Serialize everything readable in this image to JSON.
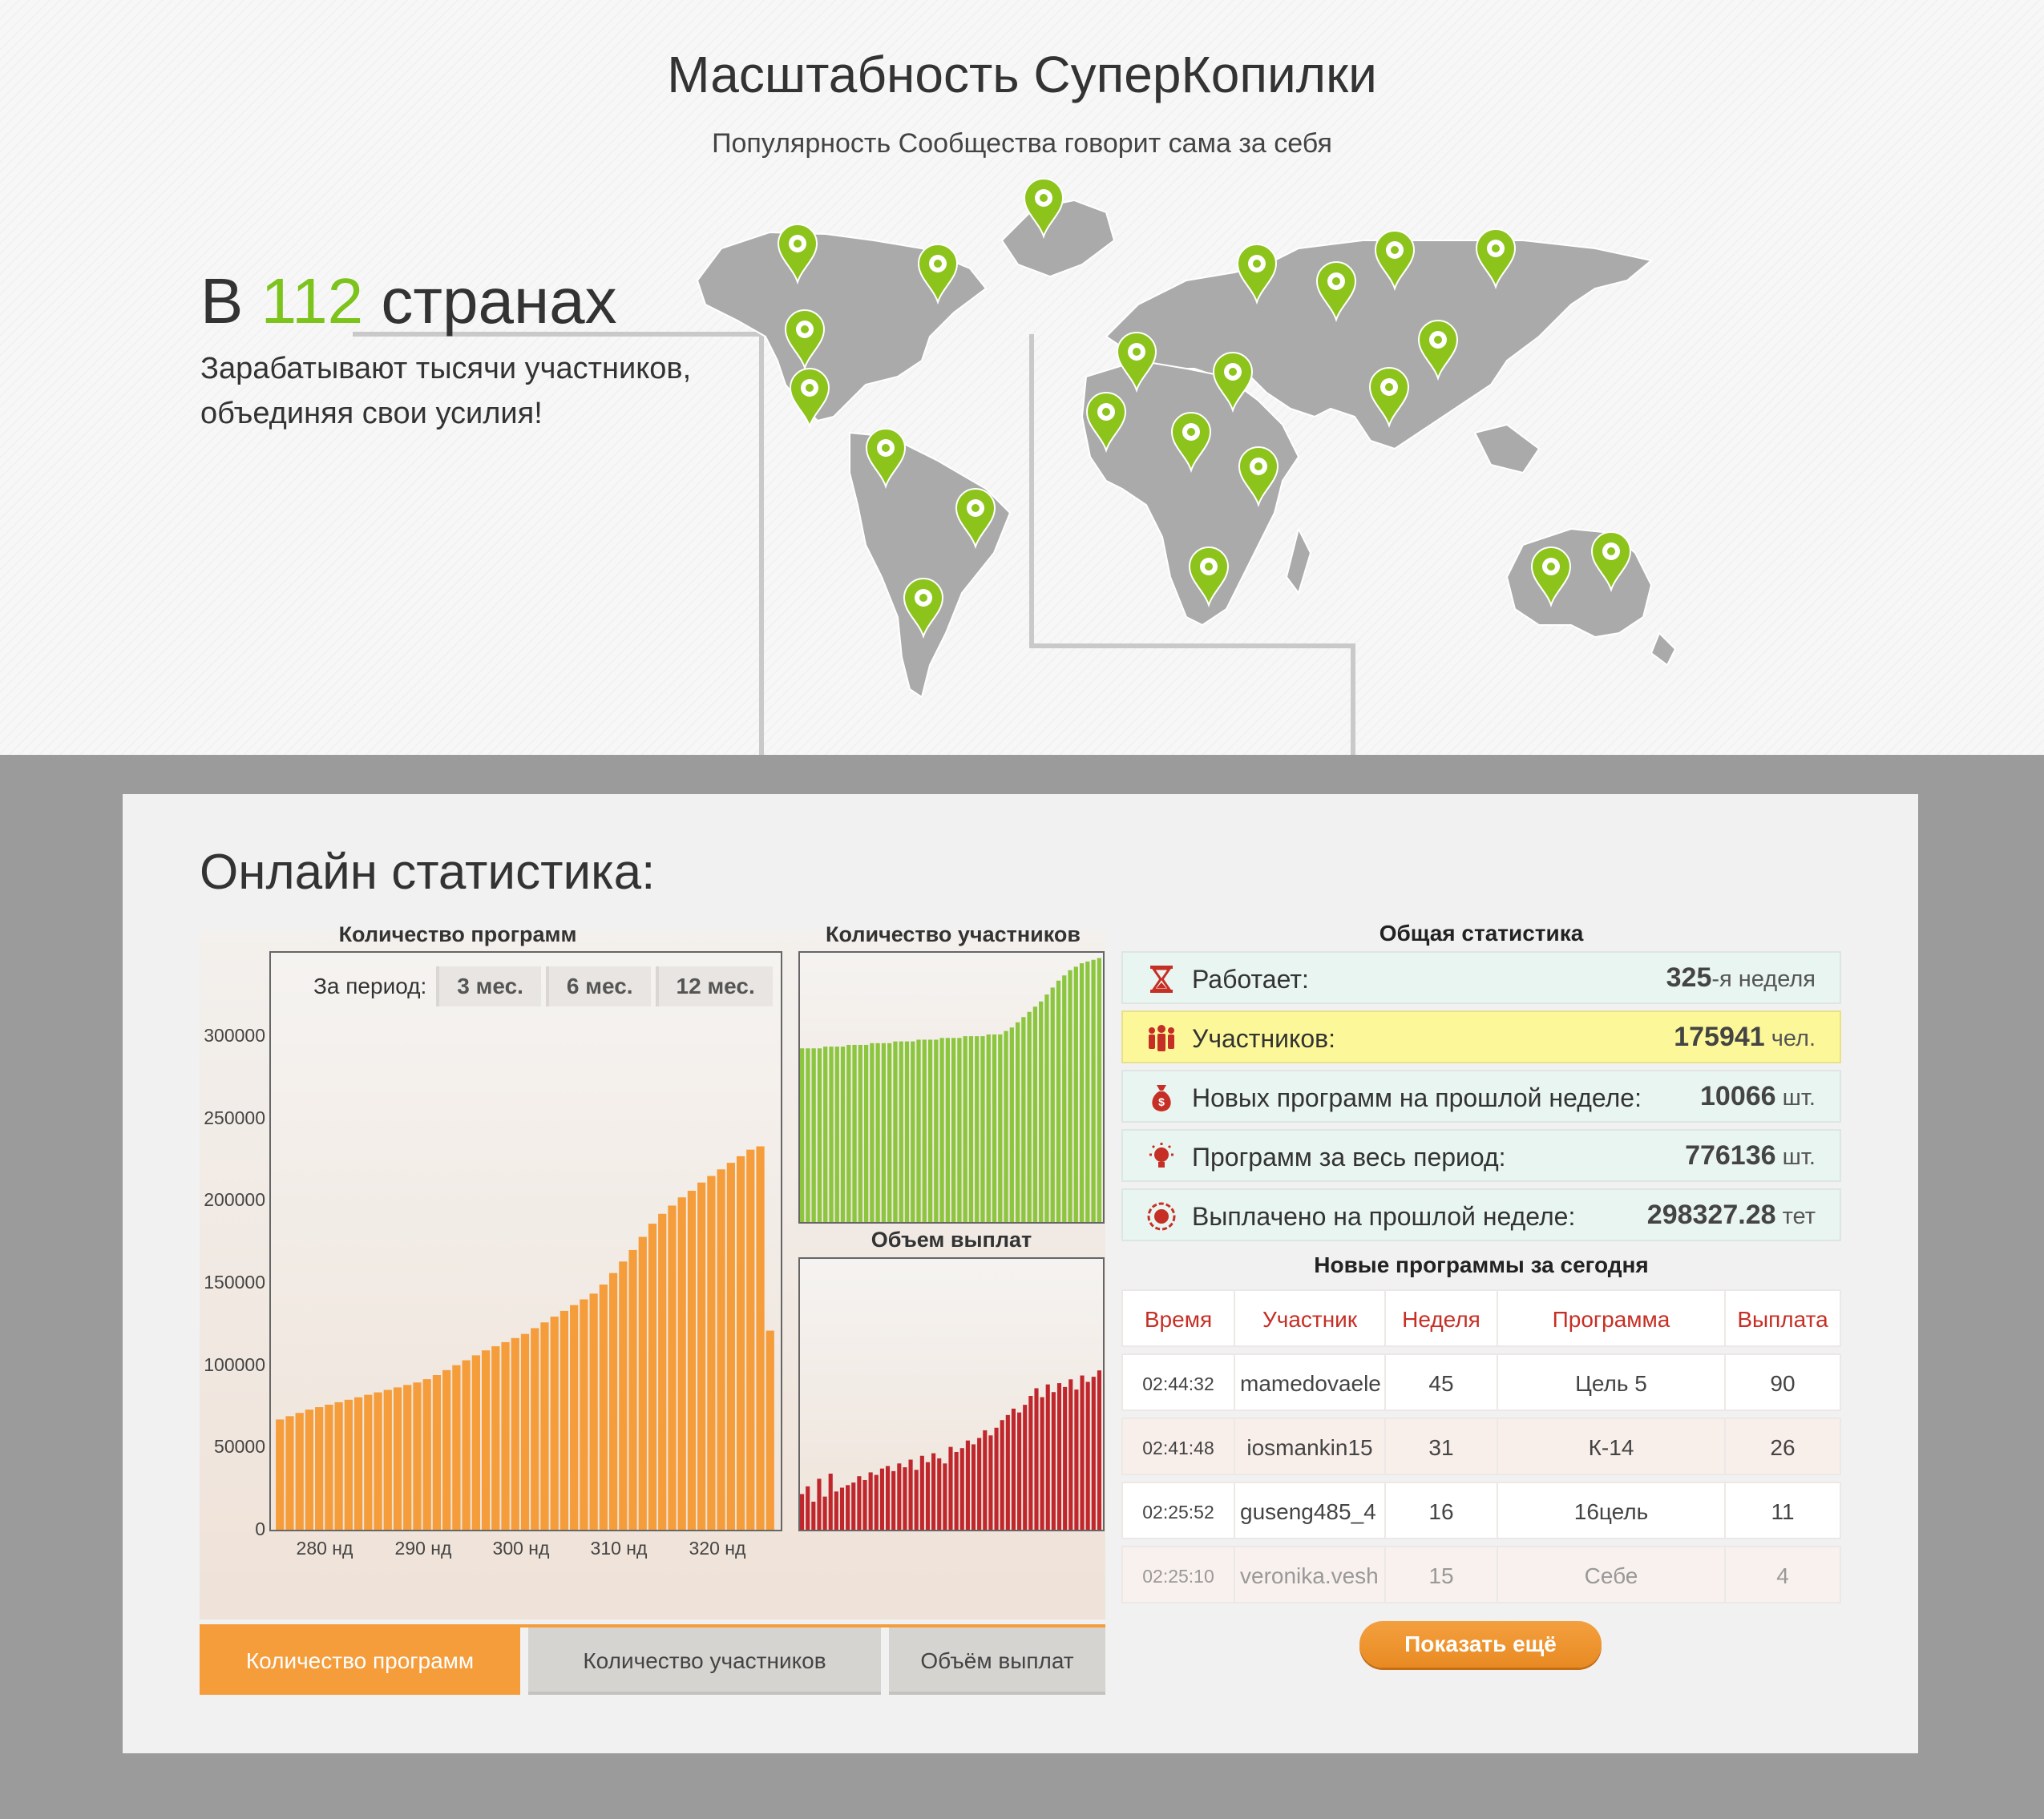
{
  "header": {
    "title": "Масштабность СуперКопилки",
    "subtitle": "Популярность Сообщества говорит сама за себя"
  },
  "reach": {
    "prefix": "В",
    "count": "112",
    "suffix": "странах",
    "description": "Зарабатывают тысячи участников, объединяя свои усилия!"
  },
  "stats": {
    "title": "Онлайн статистика:",
    "colors": {
      "accent": "#f59d3b",
      "green": "#8cc63f",
      "red": "#c0272d",
      "brand_green": "#7cc31c"
    },
    "period": {
      "label": "За период:",
      "options": [
        "3 мес.",
        "6 мес.",
        "12 мес."
      ]
    },
    "tabs": [
      "Количество программ",
      "Количество участников",
      "Объём выплат"
    ],
    "active_tab": 0,
    "general": {
      "title": "Общая статистика",
      "rows": [
        {
          "icon": "hourglass-icon",
          "label": "Работает:",
          "value": "325",
          "unit": "-я неделя",
          "highlight": false
        },
        {
          "icon": "people-icon",
          "label": "Участников:",
          "value": "175941",
          "unit": " чел.",
          "highlight": true
        },
        {
          "icon": "money-bag-icon",
          "label": "Новых программ на прошлой неделе:",
          "value": "10066",
          "unit": " шт.",
          "highlight": false
        },
        {
          "icon": "lightbulb-icon",
          "label": "Программ за весь период:",
          "value": "776136",
          "unit": " шт.",
          "highlight": false
        },
        {
          "icon": "payout-icon",
          "label": "Выплачено на прошлой неделе:",
          "value": "298327.28",
          "unit": " тет",
          "highlight": false
        }
      ]
    },
    "new_programs": {
      "title": "Новые программы за сегодня",
      "columns": [
        "Время",
        "Участник",
        "Неделя",
        "Программа",
        "Выплата"
      ],
      "rows": [
        [
          "02:44:32",
          "mamedovaele",
          "45",
          "Цель 5",
          "90"
        ],
        [
          "02:41:48",
          "iosmankin15",
          "31",
          "К-14",
          "26"
        ],
        [
          "02:25:52",
          "guseng485_4",
          "16",
          "16цель",
          "11"
        ],
        [
          "02:25:10",
          "veronika.vesh",
          "15",
          "Себе",
          "4"
        ]
      ],
      "show_more": "Показать ещё"
    }
  },
  "chart_data": [
    {
      "type": "bar",
      "title": "Количество программ",
      "color": "#f59d3b",
      "x_ticks": [
        "280 нд",
        "290 нд",
        "300 нд",
        "310 нд",
        "320 нд"
      ],
      "y_ticks": [
        "300000",
        "250000",
        "200000",
        "150000",
        "100000",
        "50000",
        "0"
      ],
      "ylim": [
        0,
        300000
      ],
      "x": [
        275,
        276,
        277,
        278,
        279,
        280,
        281,
        282,
        283,
        284,
        285,
        286,
        287,
        288,
        289,
        290,
        291,
        292,
        293,
        294,
        295,
        296,
        297,
        298,
        299,
        300,
        301,
        302,
        303,
        304,
        305,
        306,
        307,
        308,
        309,
        310,
        311,
        312,
        313,
        314,
        315,
        316,
        317,
        318,
        319,
        320,
        321,
        322,
        323,
        324,
        325
      ],
      "values": [
        67000,
        69000,
        71000,
        73000,
        74500,
        76000,
        77500,
        79000,
        80500,
        82000,
        83500,
        85000,
        86500,
        88000,
        89500,
        91500,
        94000,
        97000,
        100000,
        103000,
        106000,
        109000,
        111500,
        114000,
        116500,
        119000,
        122500,
        126000,
        129500,
        133000,
        136500,
        140000,
        143500,
        149000,
        156000,
        163000,
        170000,
        178000,
        186000,
        192000,
        197000,
        202000,
        206000,
        211000,
        215000,
        219000,
        223000,
        227000,
        231000,
        233000,
        121000
      ]
    },
    {
      "type": "bar",
      "title": "Количество участников",
      "color": "#8cc63f",
      "values": [
        100,
        100,
        100,
        100,
        101,
        101,
        101,
        101,
        102,
        102,
        102,
        102,
        103,
        103,
        103,
        103,
        104,
        104,
        104,
        104,
        105,
        105,
        105,
        105,
        106,
        106,
        106,
        106,
        107,
        107,
        107,
        107,
        108,
        108,
        108,
        110,
        112,
        115,
        118,
        121,
        124,
        127,
        131,
        135,
        139,
        142,
        145,
        147,
        149,
        150,
        151,
        152
      ]
    },
    {
      "type": "bar",
      "title": "Объем выплат",
      "color": "#c0272d",
      "values": [
        28,
        34,
        22,
        40,
        26,
        44,
        30,
        33,
        35,
        37,
        42,
        39,
        45,
        43,
        48,
        50,
        46,
        52,
        49,
        55,
        47,
        58,
        53,
        60,
        56,
        52,
        65,
        61,
        64,
        70,
        67,
        72,
        78,
        74,
        80,
        86,
        90,
        95,
        92,
        98,
        105,
        111,
        104,
        114,
        108,
        115,
        112,
        118,
        110,
        121,
        116,
        120,
        125
      ]
    }
  ]
}
